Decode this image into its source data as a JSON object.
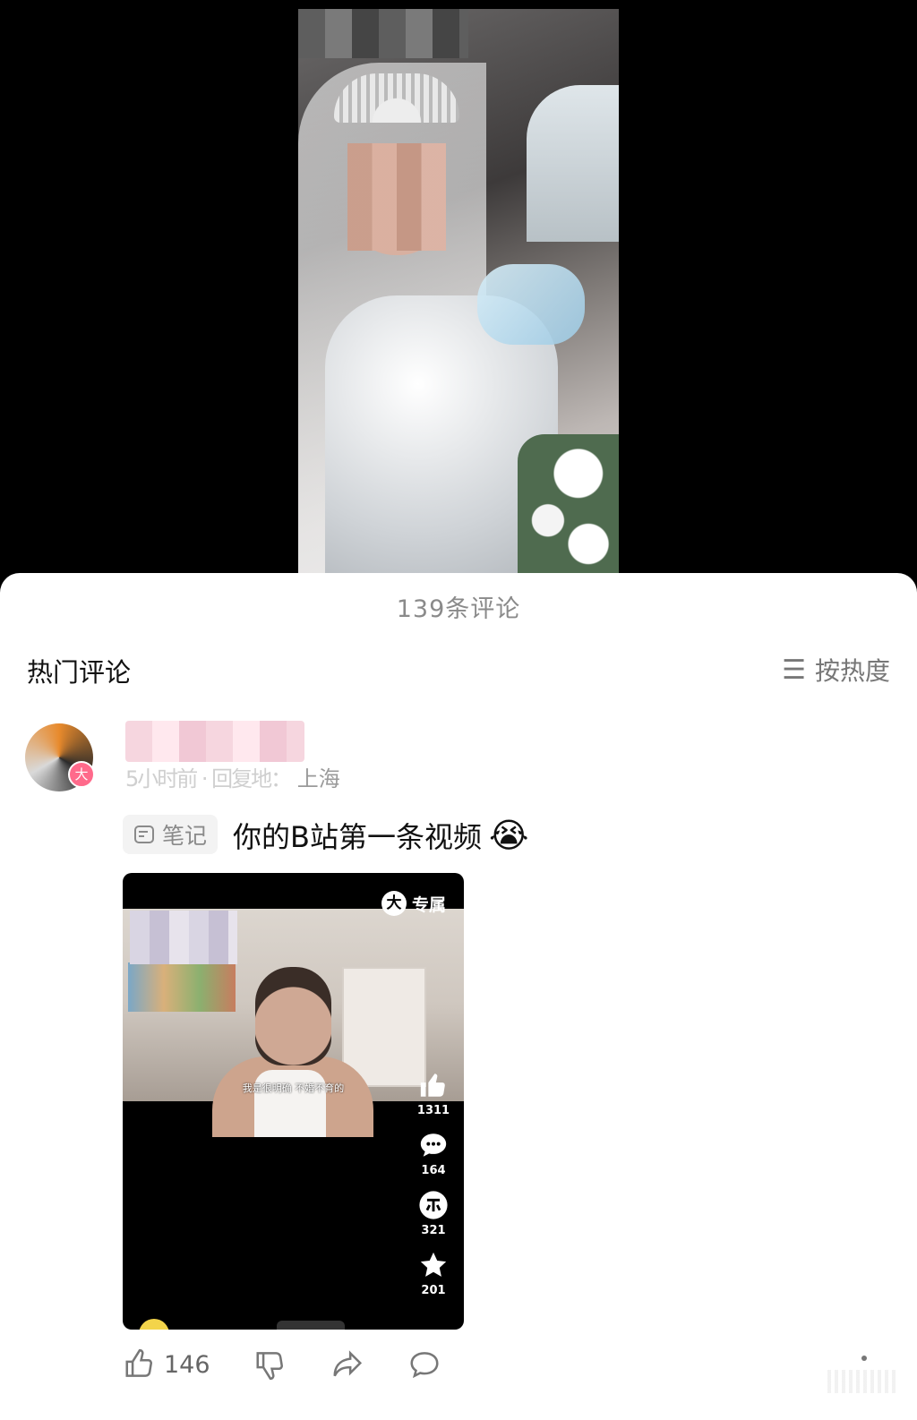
{
  "comments_panel": {
    "count_label": "139条评论",
    "section_title": "热门评论",
    "sort_label": "按热度"
  },
  "comment": {
    "location_prefix": "5小时前 · 回复地：",
    "location": "上海",
    "tag_label": "笔记",
    "text": "你的B站第一条视频",
    "emoji": "😭"
  },
  "video_card": {
    "exclusive_badge": "大",
    "exclusive_label": "专属",
    "subtitle": "我是很明确 不婚不育的",
    "stats": {
      "likes": "1311",
      "comments": "164",
      "coins": "321",
      "favorites": "201"
    }
  },
  "actions": {
    "like_count": "146"
  },
  "avatar_badge": "大",
  "icons": {
    "sort": "list-icon",
    "note": "note-icon",
    "like": "thumbs-up-icon",
    "dislike": "thumbs-down-icon",
    "share": "share-icon",
    "reply": "comment-bubble-icon"
  }
}
